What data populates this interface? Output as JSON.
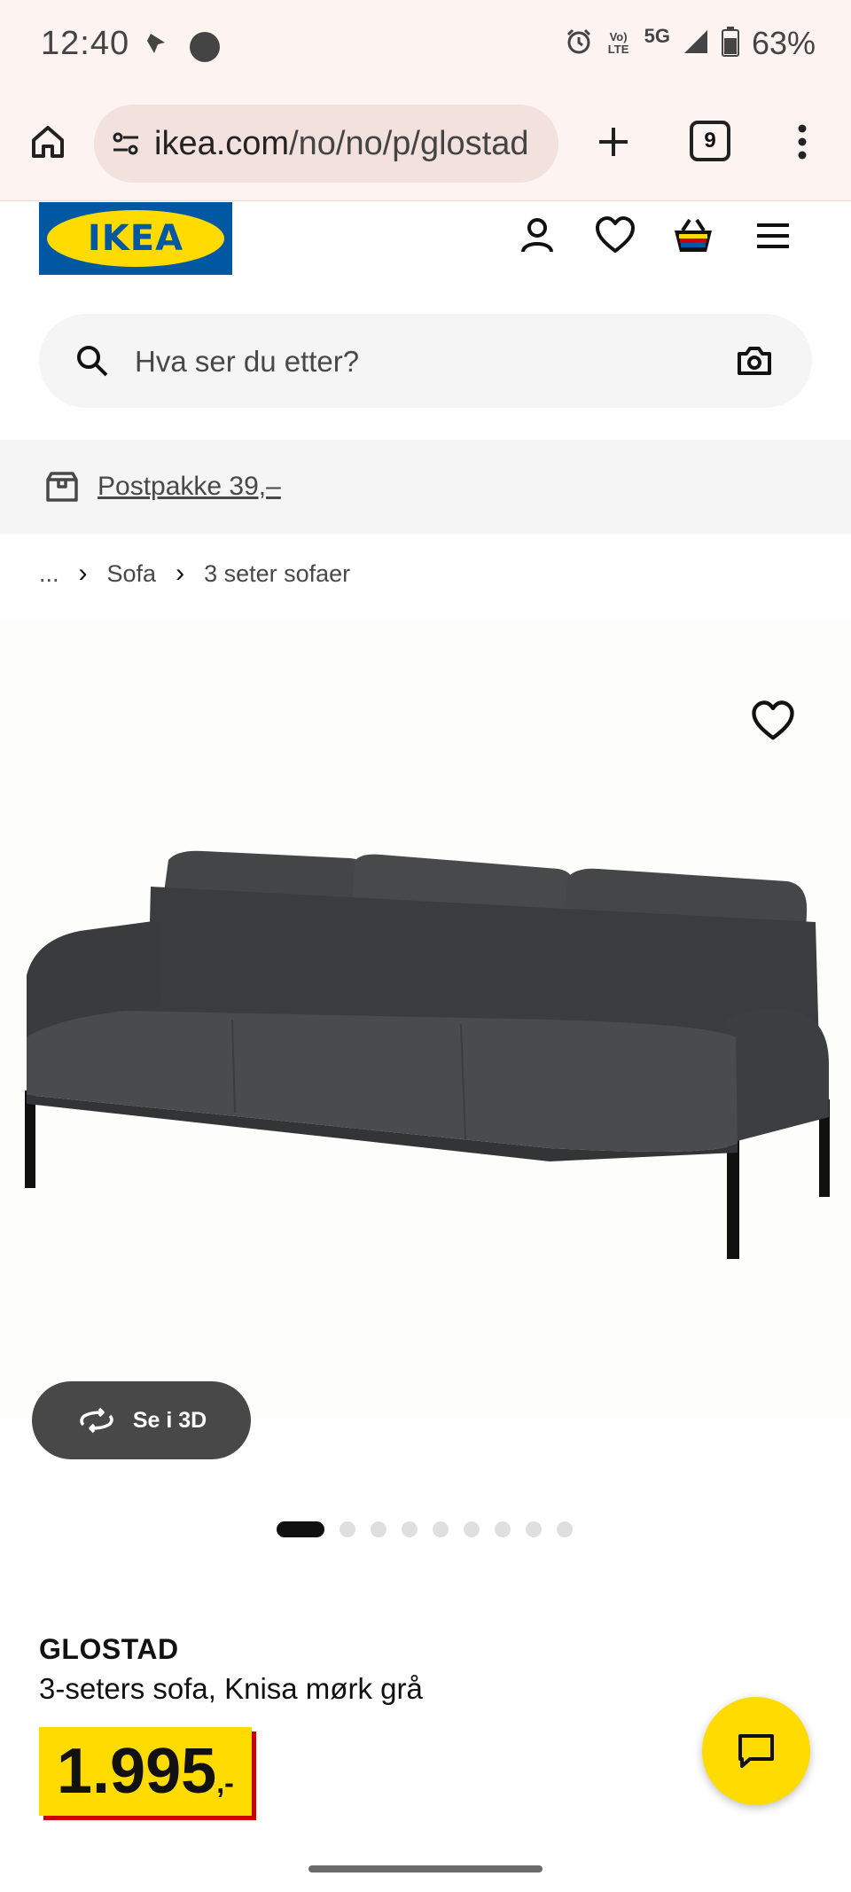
{
  "status_bar": {
    "time": "12:40",
    "network": "5G",
    "volte": "Vo) LTE",
    "battery": "63%"
  },
  "browser": {
    "url_host": "ikea.com",
    "url_path": "/no/no/p/glostad",
    "tab_count": "9"
  },
  "header": {
    "logo_text": "IKEA"
  },
  "search": {
    "placeholder": "Hva ser du etter?"
  },
  "shipping": {
    "text": "Postpakke 39,–"
  },
  "breadcrumb": {
    "items": [
      "...",
      "Sofa",
      "3 seter sofaer"
    ]
  },
  "gallery": {
    "view_3d_label": "Se i 3D",
    "image_count": 9,
    "active_index": 0
  },
  "product": {
    "name": "GLOSTAD",
    "description": "3-seters sofa, Knisa mørk grå",
    "price_integer": "1.995",
    "price_suffix": ",-"
  },
  "colors": {
    "ikea_blue": "#0058a3",
    "ikea_yellow": "#ffdb00",
    "price_shadow_red": "#cc0008",
    "browser_chrome": "#fdf3f1"
  }
}
